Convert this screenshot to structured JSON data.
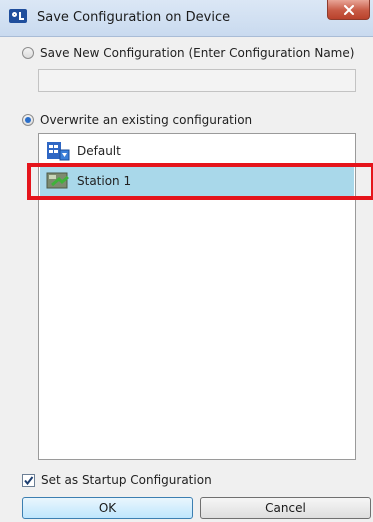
{
  "window": {
    "title": "Save Configuration on Device",
    "close_icon": "close-icon"
  },
  "options": {
    "save_new_label": "Save New Configuration (Enter Configuration Name)",
    "save_new_selected": false,
    "name_input_value": "",
    "overwrite_label": "Overwrite an existing configuration",
    "overwrite_selected": true
  },
  "configurations": [
    {
      "label": "Default",
      "icon": "default-config-icon",
      "selected": false
    },
    {
      "label": "Station 1",
      "icon": "station-config-icon",
      "selected": true
    }
  ],
  "startup": {
    "label": "Set as Startup Configuration",
    "checked": true
  },
  "buttons": {
    "ok_label": "OK",
    "cancel_label": "Cancel"
  },
  "colors": {
    "selection": "#a9d8ea",
    "highlight_box": "#e5141b"
  }
}
